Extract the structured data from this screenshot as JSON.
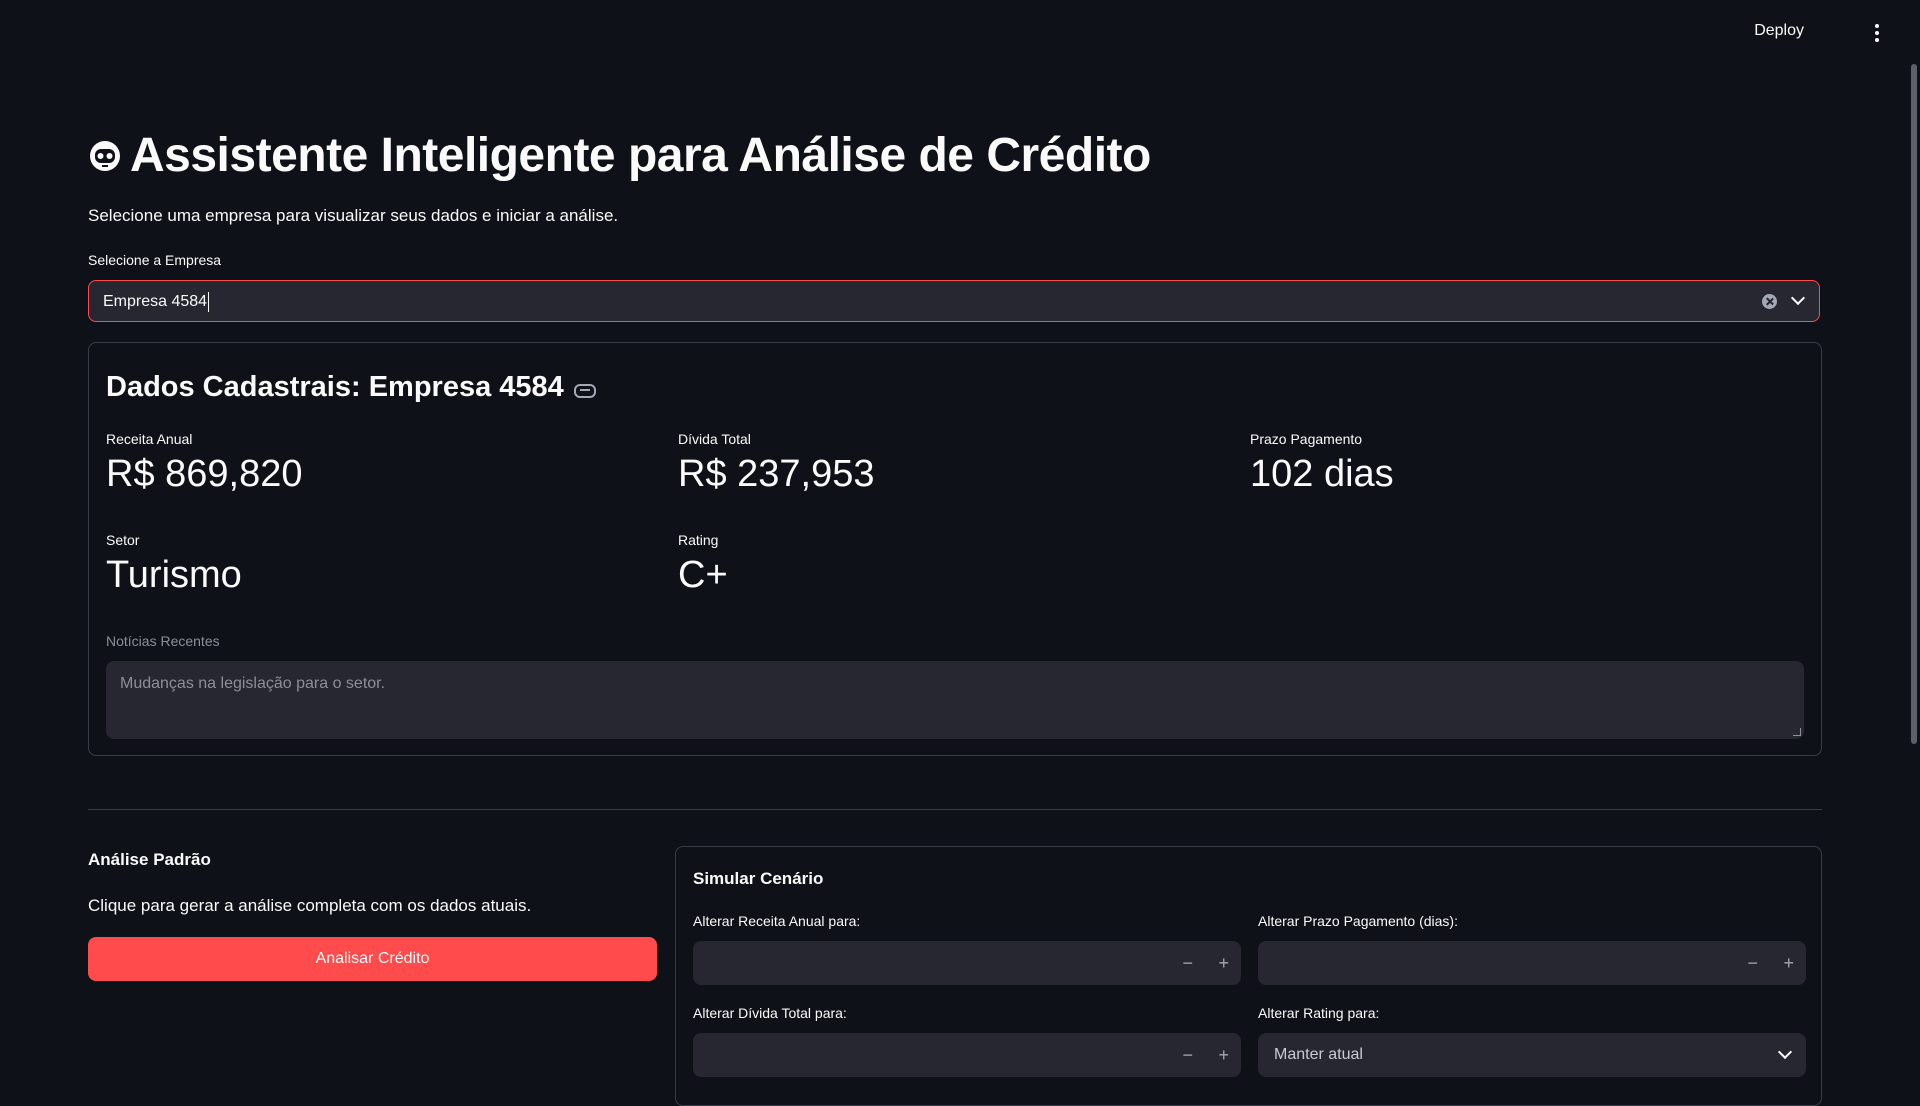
{
  "topbar": {
    "deploy_label": "Deploy"
  },
  "page": {
    "title": "Assistente Inteligente para Análise de Crédito",
    "subtitle": "Selecione uma empresa para visualizar seus dados e iniciar a análise."
  },
  "company_select": {
    "label": "Selecione a Empresa",
    "value": "Empresa 4584"
  },
  "company_card": {
    "heading": "Dados Cadastrais: Empresa 4584",
    "metrics": [
      {
        "label": "Receita Anual",
        "value": "R$ 869,820"
      },
      {
        "label": "Dívida Total",
        "value": "R$ 237,953"
      },
      {
        "label": "Prazo Pagamento",
        "value": "102 dias"
      },
      {
        "label": "Setor",
        "value": "Turismo"
      },
      {
        "label": "Rating",
        "value": "C+"
      }
    ],
    "news": {
      "label": "Notícias Recentes",
      "value": "Mudanças na legislação para o setor."
    }
  },
  "standard_analysis": {
    "title": "Análise Padrão",
    "description": "Clique para gerar a análise completa com os dados atuais.",
    "button_label": "Analisar Crédito"
  },
  "simulation": {
    "title": "Simular Cenário",
    "fields": {
      "revenue_label": "Alterar Receita Anual para:",
      "term_label": "Alterar Prazo Pagamento (dias):",
      "debt_label": "Alterar Dívida Total para:",
      "rating_label": "Alterar Rating para:",
      "rating_value": "Manter atual"
    },
    "minus": "−",
    "plus": "+"
  },
  "colors": {
    "accent": "#ff4b4b",
    "background": "#0e1117",
    "input_bg": "#262730"
  }
}
